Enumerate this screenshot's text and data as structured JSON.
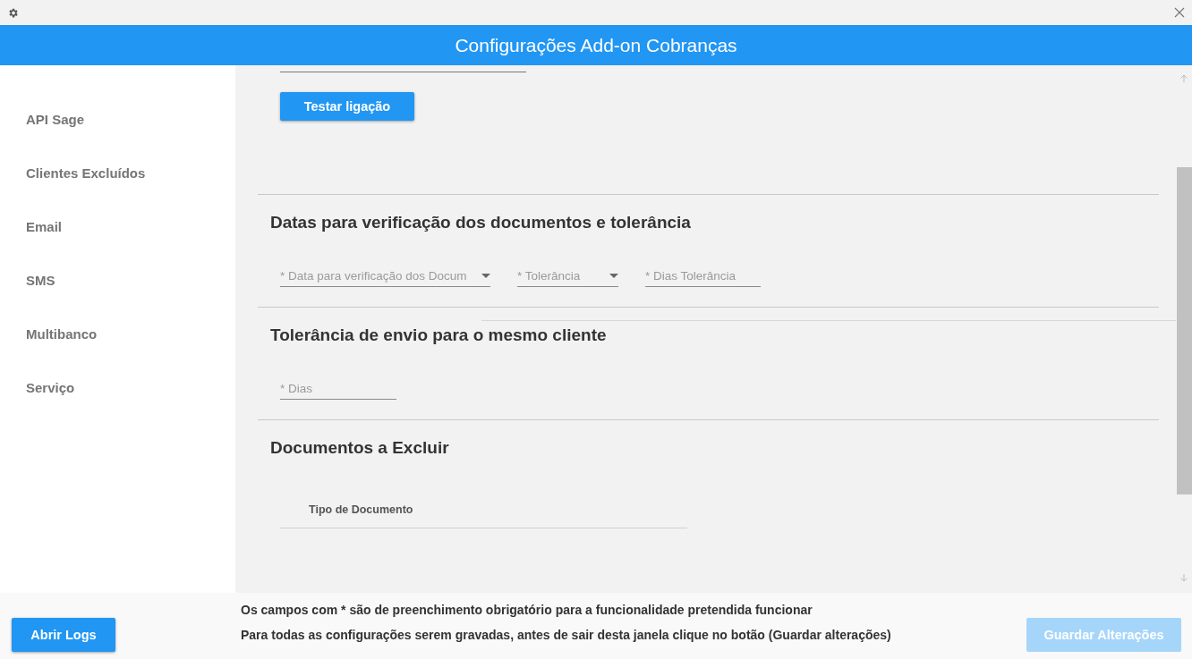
{
  "window": {
    "title": "Configurações Add-on Cobranças"
  },
  "sidebar": {
    "items": [
      {
        "label": "API Sage",
        "selected": false
      },
      {
        "label": "Clientes Excluídos",
        "selected": false
      },
      {
        "label": "Email",
        "selected": false
      },
      {
        "label": "SMS",
        "selected": false
      },
      {
        "label": "Multibanco",
        "selected": false
      },
      {
        "label": "Serviço",
        "selected": false
      }
    ]
  },
  "test_button": "Testar ligação",
  "sections": [
    {
      "title": "Datas para verificação dos documentos e tolerância",
      "fields": [
        {
          "kind": "select",
          "placeholder": "* Data para verificação dos Docum"
        },
        {
          "kind": "select",
          "placeholder": "* Tolerância"
        },
        {
          "kind": "input",
          "placeholder": "* Dias Tolerância"
        }
      ]
    },
    {
      "title": "Tolerância de envio para o mesmo cliente",
      "fields": [
        {
          "kind": "input",
          "placeholder": "* Dias"
        }
      ]
    },
    {
      "title": "Documentos a Excluir",
      "table": {
        "columns": [
          "Tipo de Documento"
        ]
      }
    }
  ],
  "footer": {
    "logs_button": "Abrir Logs",
    "notes": [
      "Os campos com * são de preenchimento obrigatório para a funcionalidade pretendida funcionar",
      "Para todas as configurações serem gravadas, antes de sair desta janela clique no botão (Guardar alterações)"
    ],
    "save_button": {
      "label": "Guardar Alterações",
      "disabled": true
    }
  }
}
